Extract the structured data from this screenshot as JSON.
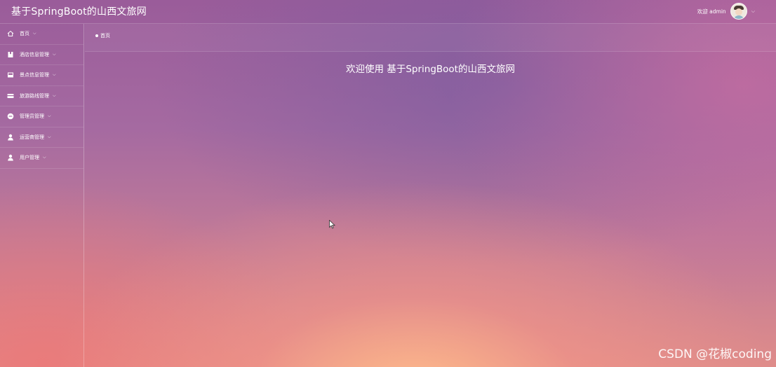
{
  "header": {
    "title": "基于SpringBoot的山西文旅网",
    "welcome": "欢迎 admin",
    "user_menu_icon": "chevron-down-icon"
  },
  "sidebar": {
    "items": [
      {
        "label": "首页",
        "icon": "home-icon"
      },
      {
        "label": "酒店信息管理",
        "icon": "bookmark-icon"
      },
      {
        "label": "景点信息管理",
        "icon": "picture-icon"
      },
      {
        "label": "旅游路线管理",
        "icon": "card-icon"
      },
      {
        "label": "管理员管理",
        "icon": "minus-circle-icon"
      },
      {
        "label": "运营商管理",
        "icon": "user-icon"
      },
      {
        "label": "用户管理",
        "icon": "user-icon"
      }
    ]
  },
  "breadcrumb": {
    "current": "首页"
  },
  "main": {
    "welcome_heading": "欢迎使用 基于SpringBoot的山西文旅网"
  },
  "watermark": "CSDN @花椒coding"
}
